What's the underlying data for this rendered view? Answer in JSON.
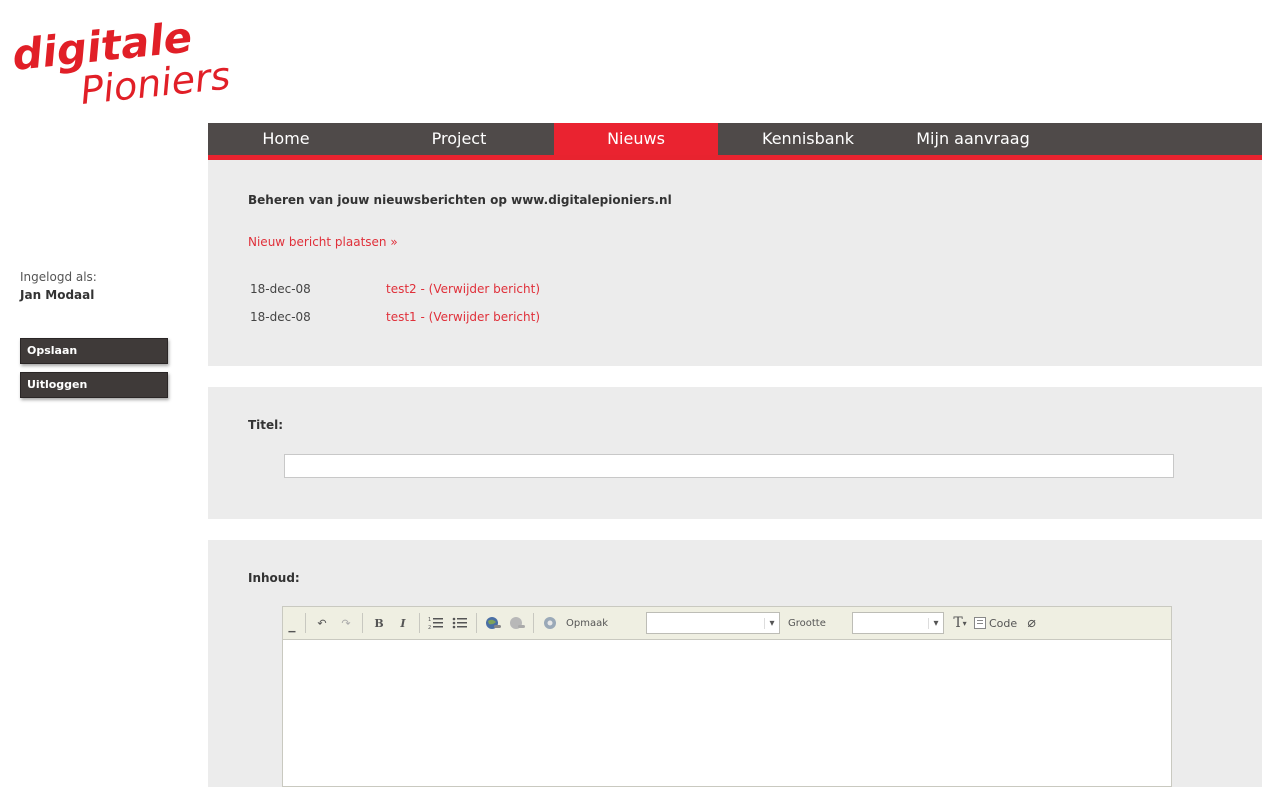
{
  "logo": {
    "line1": "digitale",
    "line2": "Pioniers"
  },
  "sidebar": {
    "logged_in_label": "Ingelogd als:",
    "user_name": "Jan Modaal",
    "buttons": [
      "Opslaan",
      "Uitloggen"
    ]
  },
  "nav": {
    "items": [
      "Home",
      "Project",
      "Nieuws",
      "Kennisbank",
      "Mijn aanvraag"
    ],
    "active": "Nieuws"
  },
  "manage": {
    "title": "Beheren van jouw nieuwsberichten op www.digitalepioniers.nl",
    "new_link": "Nieuw bericht plaatsen »",
    "rows": [
      {
        "date": "18-dec-08",
        "link": "test2 - (Verwijder bericht)"
      },
      {
        "date": "18-dec-08",
        "link": "test1 - (Verwijder bericht)"
      }
    ]
  },
  "form": {
    "title_label": "Titel:",
    "title_value": "",
    "content_label": "Inhoud:"
  },
  "editor": {
    "format_label": "Opmaak",
    "format_value": "",
    "size_label": "Grootte",
    "size_value": "",
    "code_label": "Code",
    "icons": [
      "undo-icon",
      "redo-icon",
      "bold-icon",
      "italic-icon",
      "ordered-list-icon",
      "unordered-list-icon",
      "link-icon",
      "unlink-icon",
      "image-icon",
      "text-color-icon",
      "code-icon",
      "eraser-icon"
    ]
  },
  "colors": {
    "accent": "#e8232f",
    "nav_bg": "#4f4a49",
    "panel_bg": "#ececec",
    "button_bg": "#3f3a39"
  }
}
